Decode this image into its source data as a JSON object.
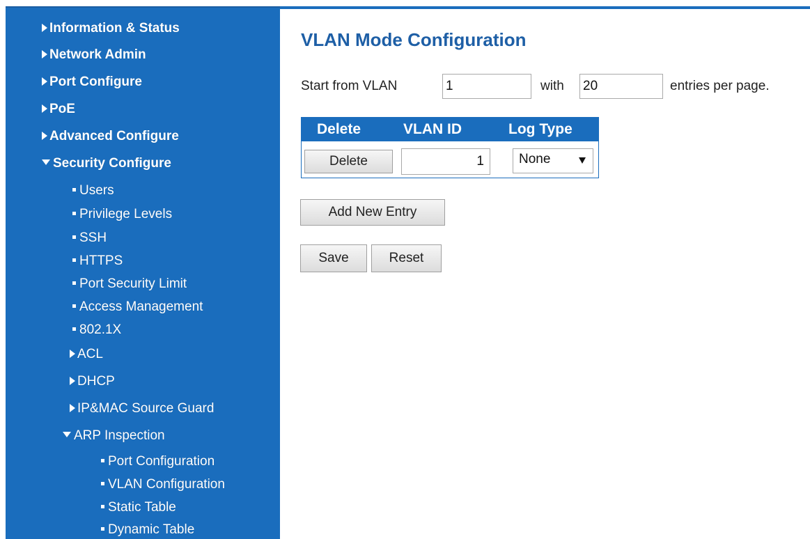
{
  "sidebar": {
    "items": [
      {
        "label": "Information & Status",
        "marker": "triangle-right-icon"
      },
      {
        "label": "Network Admin",
        "marker": "triangle-right-icon"
      },
      {
        "label": "Port Configure",
        "marker": "triangle-right-icon"
      },
      {
        "label": "PoE",
        "marker": "triangle-right-icon"
      },
      {
        "label": "Advanced Configure",
        "marker": "triangle-right-icon"
      },
      {
        "label": "Security Configure",
        "marker": "triangle-down-icon"
      }
    ],
    "security_items": [
      {
        "label": "Users",
        "marker": "bullet-icon"
      },
      {
        "label": "Privilege Levels",
        "marker": "bullet-icon"
      },
      {
        "label": "SSH",
        "marker": "bullet-icon"
      },
      {
        "label": "HTTPS",
        "marker": "bullet-icon"
      },
      {
        "label": "Port Security Limit",
        "marker": "bullet-icon"
      },
      {
        "label": "Access Management",
        "marker": "bullet-icon"
      },
      {
        "label": "802.1X",
        "marker": "bullet-icon"
      },
      {
        "label": "ACL",
        "marker": "triangle-right-icon"
      },
      {
        "label": "DHCP",
        "marker": "triangle-right-icon"
      },
      {
        "label": "IP&MAC Source Guard",
        "marker": "triangle-right-icon"
      },
      {
        "label": "ARP Inspection",
        "marker": "triangle-down-icon"
      }
    ],
    "arp_items": [
      {
        "label": "Port Configuration",
        "marker": "bullet-icon"
      },
      {
        "label": "VLAN Configuration",
        "marker": "bullet-icon"
      },
      {
        "label": "Static Table",
        "marker": "bullet-icon"
      },
      {
        "label": "Dynamic Table",
        "marker": "bullet-icon"
      }
    ]
  },
  "main": {
    "title": "VLAN Mode Configuration",
    "paging": {
      "start_label": "Start from VLAN",
      "start_value": "1",
      "with_label": "with",
      "entries_value": "20",
      "entries_label": "entries per page."
    },
    "table": {
      "headers": [
        "Delete",
        "VLAN ID",
        "Log Type"
      ],
      "rows": [
        {
          "delete_label": "Delete",
          "vlan_id": "1",
          "log_type": "None"
        }
      ]
    },
    "add_entry_label": "Add New Entry",
    "save_label": "Save",
    "reset_label": "Reset"
  },
  "colors": {
    "sidebar_bg": "#1a6dbd",
    "title": "#1e5fa6"
  }
}
